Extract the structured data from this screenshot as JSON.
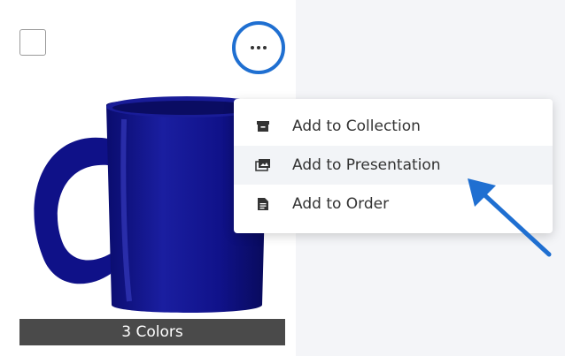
{
  "product": {
    "colors_label": "3 Colors",
    "more_button": "More options"
  },
  "menu": {
    "items": [
      {
        "label": "Add to Collection",
        "icon": "archive-box-icon"
      },
      {
        "label": "Add to Presentation",
        "icon": "image-gallery-icon"
      },
      {
        "label": "Add to Order",
        "icon": "document-icon"
      }
    ]
  },
  "colors": {
    "accent": "#1f6fd1",
    "mug": "#10128a",
    "overlay": "#4a4a4a"
  }
}
